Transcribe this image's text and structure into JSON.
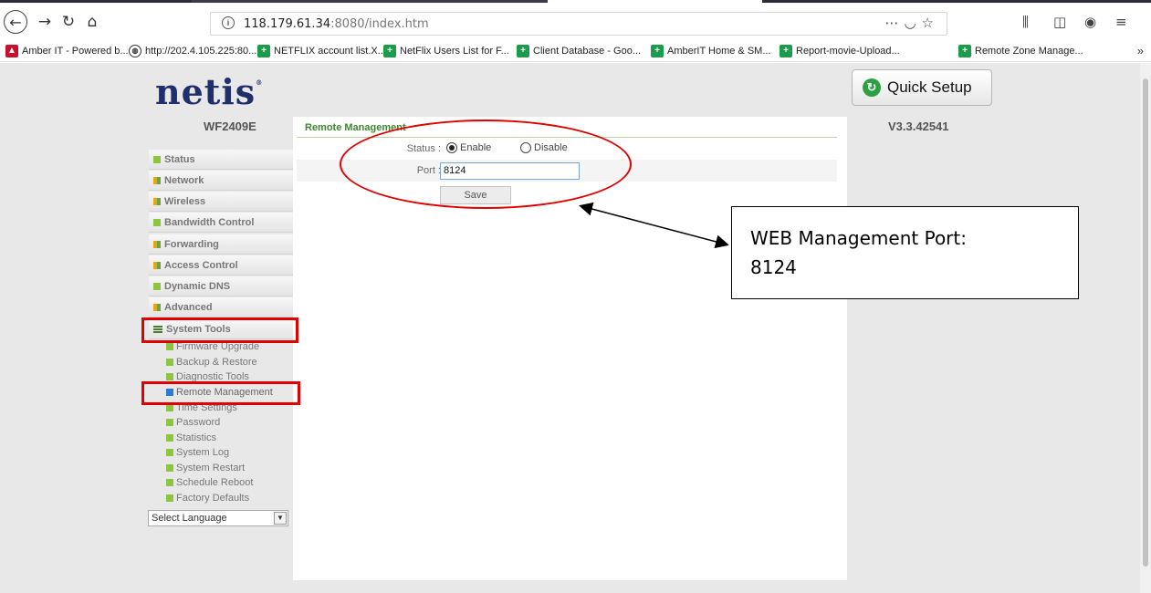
{
  "browser": {
    "url_host": "118.179.61.34",
    "url_path": ":8080/index.htm",
    "bookmarks": [
      "Amber IT - Powered b...",
      "http://202.4.105.225:80...",
      "NETFLIX account list.X...",
      "NetFlix Users List for F...",
      "Client Database - Goo...",
      "AmberIT Home & SM...",
      "Report-movie-Upload...",
      "Remote Zone Manage..."
    ],
    "more_glyph": "»"
  },
  "header": {
    "logo": "netis",
    "quick_setup": "Quick Setup",
    "model": "WF2409E",
    "version": "V3.3.42541"
  },
  "sidebar": {
    "menu": [
      "Status",
      "Network",
      "Wireless",
      "Bandwidth Control",
      "Forwarding",
      "Access Control",
      "Dynamic DNS",
      "Advanced",
      "System Tools"
    ],
    "submenu": [
      "Firmware Upgrade",
      "Backup & Restore",
      "Diagnostic Tools",
      "Remote Management",
      "Time Settings",
      "Password",
      "Statistics",
      "System Log",
      "System Restart",
      "Schedule Reboot",
      "Factory Defaults"
    ],
    "active_submenu": "Remote Management",
    "language": "Select Language"
  },
  "form": {
    "title": "Remote Management",
    "status_label": "Status :",
    "enable_label": "Enable",
    "disable_label": "Disable",
    "status_value": "Enable",
    "port_label": "Port :",
    "port_value": "8124",
    "save_label": "Save"
  },
  "annotation": {
    "line1": "WEB Management Port:",
    "line2": "8124",
    "color": "#e00000"
  }
}
